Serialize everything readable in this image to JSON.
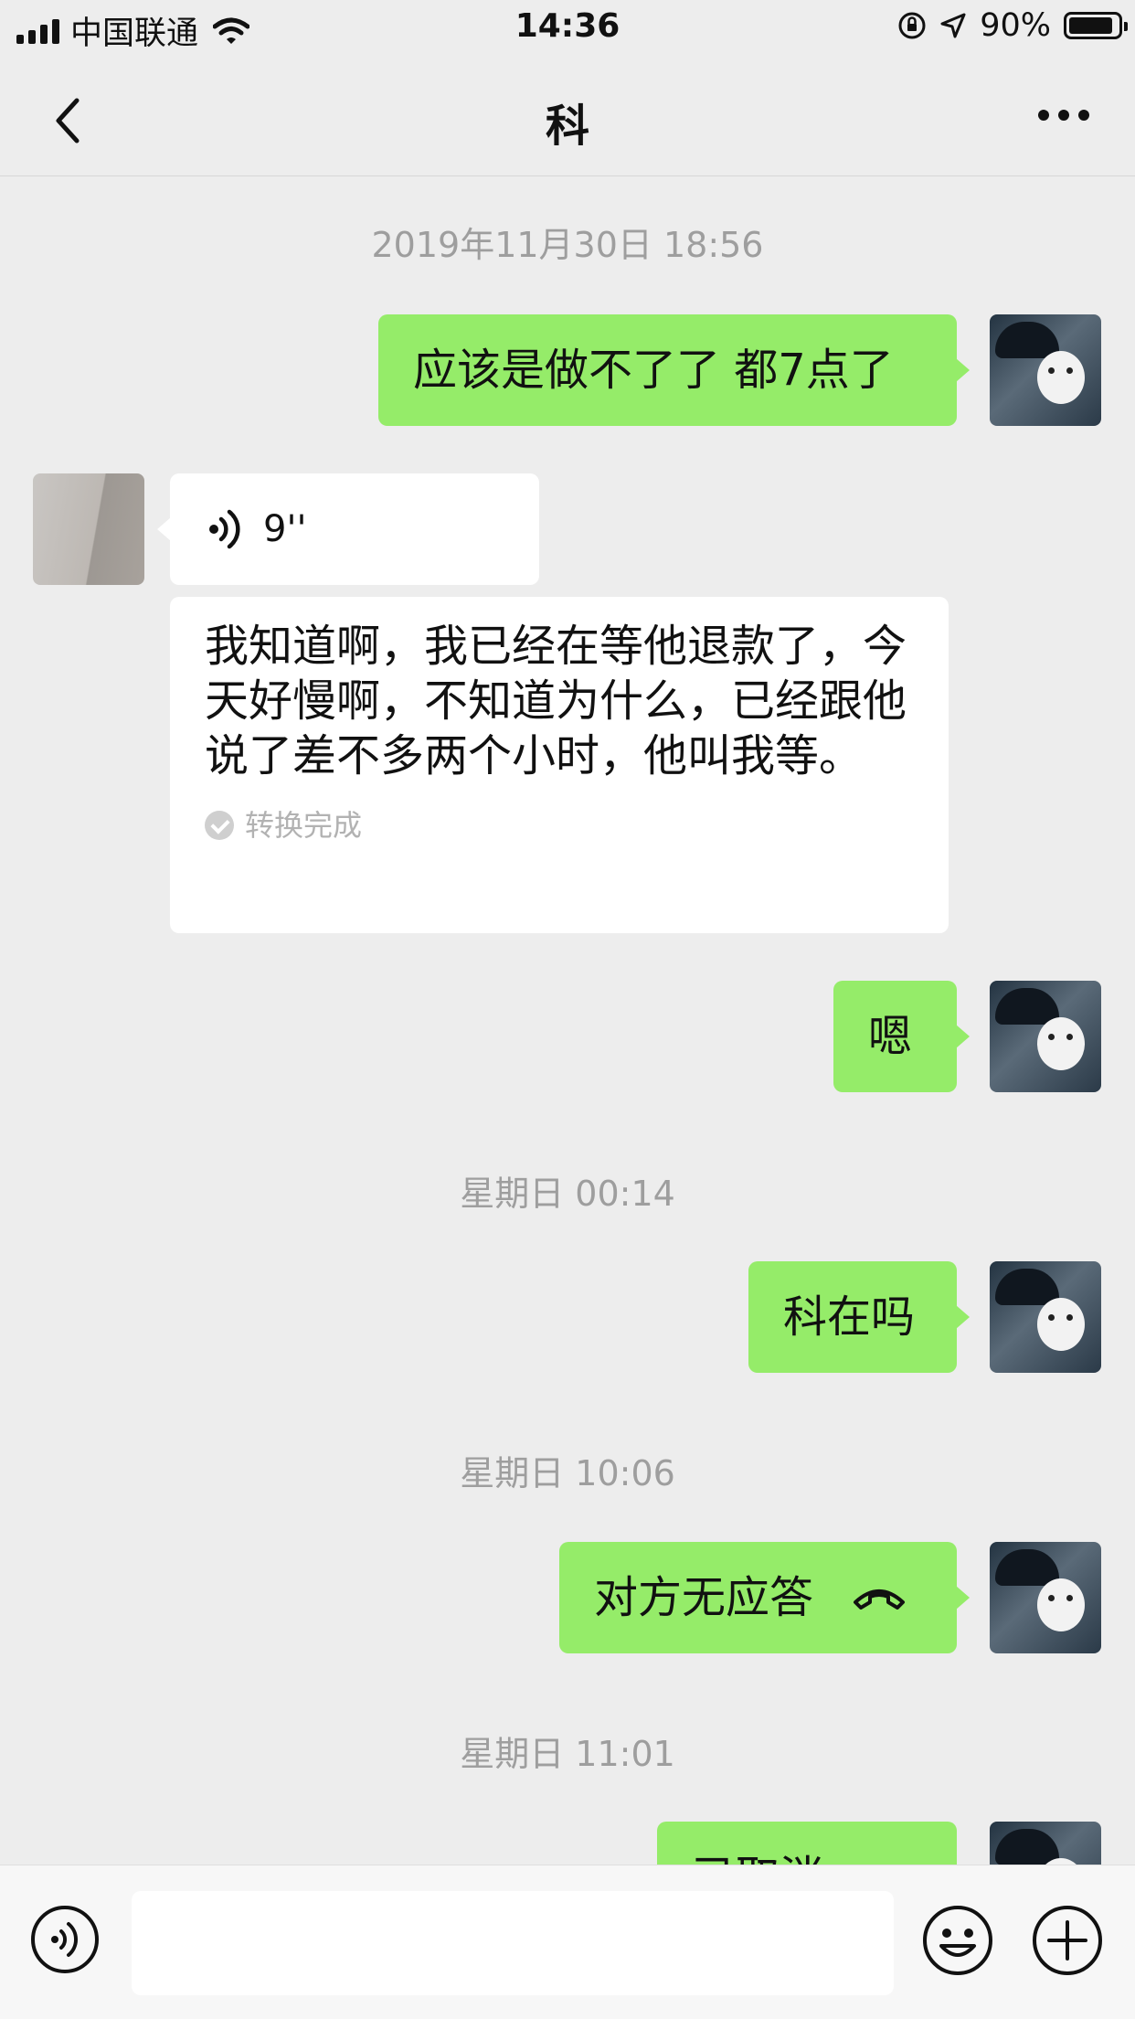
{
  "status_bar": {
    "carrier": "中国联通",
    "time": "14:36",
    "battery": "90%",
    "battery_level": 0.9
  },
  "nav": {
    "back_icon": "chevron-left-icon",
    "title": "科",
    "more_icon": "more-dots-icon"
  },
  "chat": {
    "timestamps": [
      "2019年11月30日 18:56",
      "星期日 00:14",
      "星期日 10:06",
      "星期日 11:01"
    ],
    "messages": {
      "m1": "应该是做不了了 都7点了",
      "voice_duration": "9''",
      "transcript": "我知道啊，我已经在等他退款了，今天好慢啊，不知道为什么，已经跟他说了差不多两个小时，他叫我等。",
      "transcript_status": "转换完成",
      "m2": "嗯",
      "m3": "科在吗",
      "m4": "对方无应答",
      "m5": "已取消"
    }
  },
  "input_bar": {
    "voice_icon": "voice-input-icon",
    "emoji_icon": "emoji-icon",
    "plus_icon": "plus-circle-icon",
    "text_value": ""
  },
  "colors": {
    "background": "#ededed",
    "my_bubble": "#95ec69",
    "their_bubble": "#ffffff",
    "timestamp": "#9e9e9e"
  }
}
